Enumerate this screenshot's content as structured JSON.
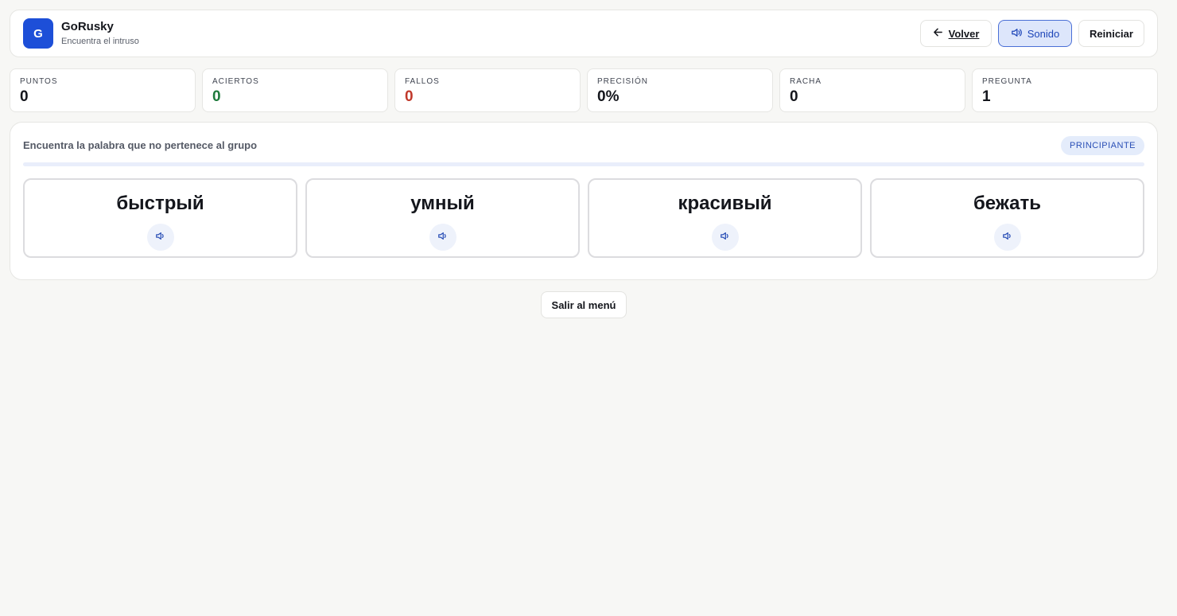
{
  "header": {
    "logo_letter": "G",
    "title": "GoRusky",
    "subtitle": "Encuentra el intruso",
    "back_label": "Volver",
    "sound_label": "Sonido",
    "restart_label": "Reiniciar"
  },
  "stats": [
    {
      "label": "PUNTOS",
      "value": "0"
    },
    {
      "label": "ACIERTOS",
      "value": "0"
    },
    {
      "label": "FALLOS",
      "value": "0"
    },
    {
      "label": "PRECISIÓN",
      "value": "0%"
    },
    {
      "label": "RACHA",
      "value": "0"
    },
    {
      "label": "PREGUNTA",
      "value": "1"
    }
  ],
  "game": {
    "instruction": "Encuentra la palabra que no pertenece al grupo",
    "level": "PRINCIPIANTE",
    "progress": 0,
    "words": [
      "быстрый",
      "умный",
      "красивый",
      "бежать"
    ]
  },
  "exit_label": "Salir al menú",
  "colors": {
    "accent": "#1d4fd8",
    "correct": "#1e7a3c",
    "wrong": "#c0392b",
    "background": "#f7f7f5"
  },
  "icons": {
    "back": "arrow-left-icon",
    "sound": "speaker-icon"
  }
}
